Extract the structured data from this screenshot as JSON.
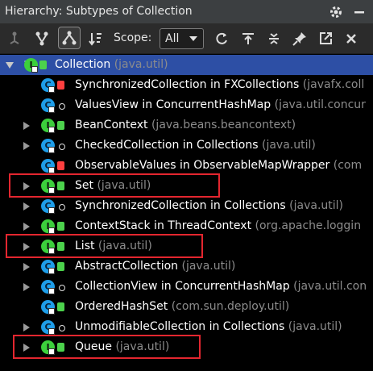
{
  "window": {
    "title": "Hierarchy:  Subtypes of Collection"
  },
  "toolbar": {
    "scope_label": "Scope:",
    "scope_value": "All",
    "tools_left": [
      "supertypes-icon",
      "subtypes-icon",
      "class-hierarchy-icon",
      "sort-icon"
    ],
    "tools_right": [
      "refresh-icon",
      "export-icon",
      "expand-all-icon",
      "pin-icon",
      "open-in-editor-icon",
      "close-icon"
    ]
  },
  "tree": {
    "rows": [
      {
        "name": "Collection",
        "pkg": "(java.util)",
        "kind": "interface",
        "modifier": "public",
        "expanded": true,
        "selected": true,
        "star": "*"
      },
      {
        "name": "SynchronizedCollection in FXCollections",
        "pkg": "(javafx.coll",
        "kind": "class",
        "modifier": "private"
      },
      {
        "name": "ValuesView in ConcurrentHashMap",
        "pkg": "(java.util.concur",
        "kind": "class",
        "modifier": "package"
      },
      {
        "name": "BeanContext",
        "pkg": "(java.beans.beancontext)",
        "kind": "interface",
        "modifier": "public",
        "expandable": true
      },
      {
        "name": "CheckedCollection in Collections",
        "pkg": "(java.util)",
        "kind": "class",
        "modifier": "package",
        "expandable": true
      },
      {
        "name": "ObservableValues in ObservableMapWrapper",
        "pkg": "(com",
        "kind": "class",
        "modifier": "private"
      },
      {
        "name": "Set",
        "pkg": "(java.util)",
        "kind": "interface",
        "modifier": "public",
        "expandable": true,
        "highlighted": true
      },
      {
        "name": "SynchronizedCollection in Collections",
        "pkg": "(java.util)",
        "kind": "class",
        "modifier": "package",
        "expandable": true
      },
      {
        "name": "ContextStack in ThreadContext",
        "pkg": "(org.apache.loggin",
        "kind": "interface",
        "modifier": "public",
        "expandable": true
      },
      {
        "name": "List",
        "pkg": "(java.util)",
        "kind": "interface",
        "modifier": "public",
        "expandable": true,
        "highlighted": true
      },
      {
        "name": "AbstractCollection",
        "pkg": "(java.util)",
        "kind": "class",
        "modifier": "public",
        "expandable": true
      },
      {
        "name": "CollectionView in ConcurrentHashMap",
        "pkg": "(java.util.con",
        "kind": "class",
        "modifier": "package",
        "expandable": true
      },
      {
        "name": "OrderedHashSet",
        "pkg": "(com.sun.deploy.util)",
        "kind": "class",
        "modifier": "public"
      },
      {
        "name": "UnmodifiableCollection in Collections",
        "pkg": "(java.util)",
        "kind": "class",
        "modifier": "package",
        "expandable": true
      },
      {
        "name": "Queue",
        "pkg": "(java.util)",
        "kind": "interface",
        "modifier": "public",
        "expandable": true,
        "highlighted": true
      }
    ]
  },
  "colors": {
    "selection": "#2d4fa5",
    "highlight_box": "#e3262f",
    "interface_badge": "#3ccf3c",
    "class_badge": "#1e9de8"
  }
}
